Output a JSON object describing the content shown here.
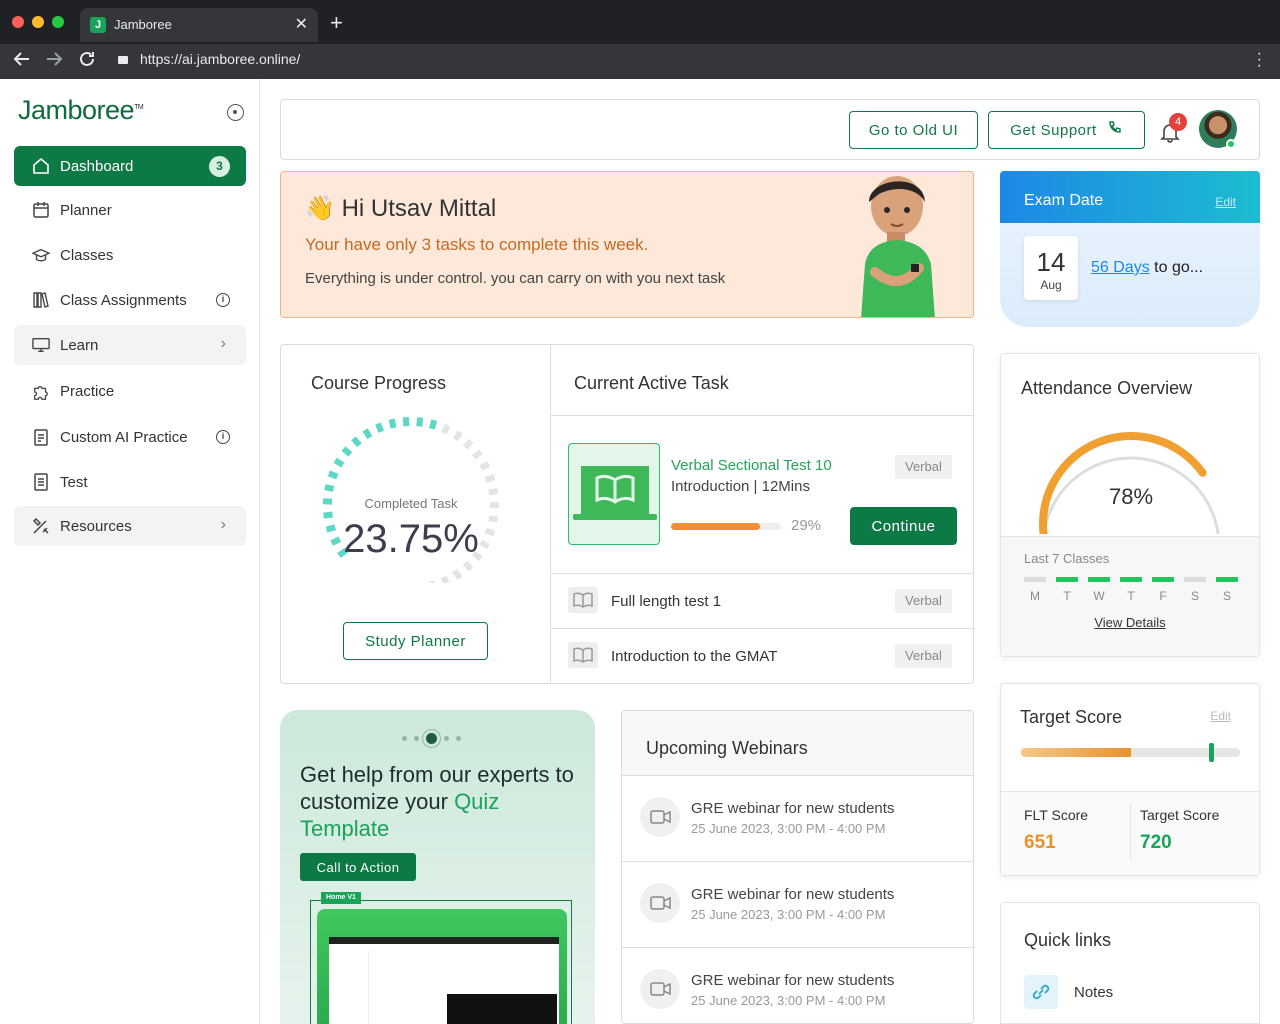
{
  "browser": {
    "tab_title": "Jamboree",
    "tab_favicon": "J",
    "url": "https://ai.jamboree.online/",
    "new_tab_glyph": "+",
    "close_glyph": "✕"
  },
  "brand": {
    "logo_text": "Jamboree",
    "logo_mark": "TM",
    "accent": "#0d7a46"
  },
  "sidebar": {
    "items": [
      {
        "label": "Dashboard",
        "icon": "home-icon",
        "badge": "3"
      },
      {
        "label": "Planner",
        "icon": "calendar-icon"
      },
      {
        "label": "Classes",
        "icon": "graduation-cap-icon"
      },
      {
        "label": "Class Assignments",
        "icon": "books-icon",
        "info": "i"
      },
      {
        "label": "Learn",
        "icon": "monitor-icon",
        "chevron": "›"
      },
      {
        "label": "Practice",
        "icon": "puzzle-icon"
      },
      {
        "label": "Custom AI Practice",
        "icon": "clipboard-icon",
        "info": "i"
      },
      {
        "label": "Test",
        "icon": "document-icon"
      },
      {
        "label": "Resources",
        "icon": "tools-icon",
        "chevron": "›"
      }
    ]
  },
  "header": {
    "old_ui_label": "Go to Old UI",
    "support_label": "Get Support",
    "notification_count": "4"
  },
  "greeting": {
    "wave": "👋",
    "title": "Hi Utsav Mittal",
    "subtitle": "Your have only 3 tasks to complete this week.",
    "body": "Everything is under control. you can carry on with you next task"
  },
  "exam": {
    "title": "Exam Date",
    "edit": "Edit",
    "day": "14",
    "month": "Aug",
    "days_link": "56 Days",
    "days_suffix": " to go..."
  },
  "course_progress": {
    "title": "Course Progress",
    "sub": "Completed Task",
    "value": "23.75%",
    "fraction": 0.2375,
    "button": "Study Planner"
  },
  "active_task": {
    "title": "Current Active Task",
    "main": {
      "name": "Verbal Sectional Test 10",
      "meta": "Introduction | 12Mins",
      "tag": "Verbal",
      "progress_label": "29%",
      "progress": 0.29,
      "button": "Continue"
    },
    "others": [
      {
        "name": "Full length test 1",
        "tag": "Verbal"
      },
      {
        "name": "Introduction to the GMAT",
        "tag": "Verbal"
      }
    ]
  },
  "attendance": {
    "title": "Attendance Overview",
    "value": "78%",
    "fraction": 0.78,
    "last_label": "Last 7 Classes",
    "days": [
      "M",
      "T",
      "W",
      "T",
      "F",
      "S",
      "S"
    ],
    "present": [
      false,
      true,
      true,
      true,
      true,
      false,
      true
    ],
    "link": "View Details",
    "colors": {
      "present": "#22c55e",
      "absent": "#dddddd",
      "arc": "#f0a030"
    }
  },
  "promo": {
    "title_part1": "Get help from our experts to customize your ",
    "title_highlight": "Quiz Template",
    "button": "Call to Action",
    "mock_tag": "Home V1"
  },
  "webinars": {
    "title": "Upcoming Webinars",
    "items": [
      {
        "name": "GRE webinar for new students",
        "date": "25 June 2023, 3:00 PM - 4:00 PM"
      },
      {
        "name": "GRE webinar for new students",
        "date": "25 June 2023, 3:00 PM - 4:00 PM"
      },
      {
        "name": "GRE webinar for new students",
        "date": "25 June 2023, 3:00 PM - 4:00 PM"
      }
    ]
  },
  "target": {
    "title": "Target Score",
    "edit": "Edit",
    "flt_label": "FLT Score",
    "flt_value": "651",
    "target_label": "Target Score",
    "target_value": "720",
    "fill_fraction": 0.5,
    "marker_fraction": 0.86,
    "colors": {
      "flt": "#e8922f",
      "target": "#1aa35a"
    }
  },
  "quick_links": {
    "title": "Quick links",
    "items": [
      {
        "label": "Notes",
        "icon": "link-icon"
      }
    ]
  }
}
